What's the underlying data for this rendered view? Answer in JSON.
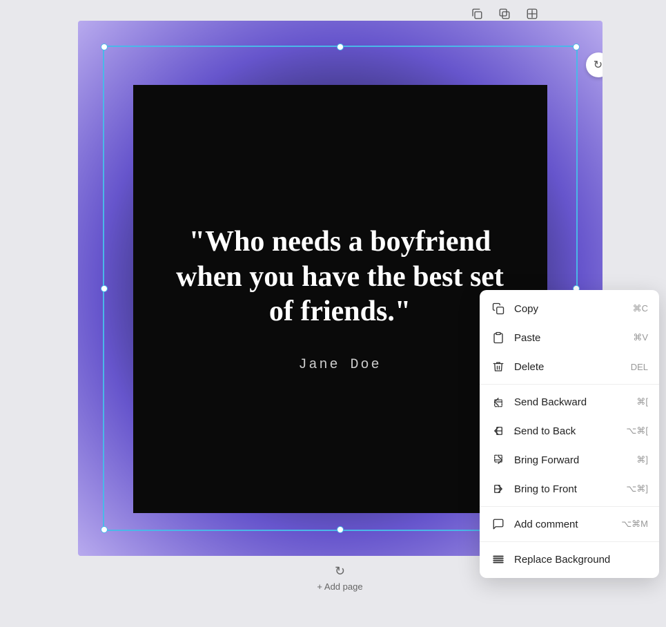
{
  "toolbar": {
    "icons": [
      "duplicate",
      "duplicate-page",
      "add-page"
    ]
  },
  "canvas": {
    "quote": "\"Who needs a boyfriend when you have the best set of friends.\"",
    "author": "Jane Doe"
  },
  "add_page_label": "+ Add page",
  "context_menu": {
    "items": [
      {
        "id": "copy",
        "label": "Copy",
        "shortcut": "⌘C",
        "icon": "copy"
      },
      {
        "id": "paste",
        "label": "Paste",
        "shortcut": "⌘V",
        "icon": "paste"
      },
      {
        "id": "delete",
        "label": "Delete",
        "shortcut": "DEL",
        "icon": "trash"
      },
      {
        "id": "send-backward",
        "label": "Send Backward",
        "shortcut": "⌘[",
        "icon": "send-backward"
      },
      {
        "id": "send-to-back",
        "label": "Send to Back",
        "shortcut": "⌥⌘[",
        "icon": "send-to-back"
      },
      {
        "id": "bring-forward",
        "label": "Bring Forward",
        "shortcut": "⌘]",
        "icon": "bring-forward"
      },
      {
        "id": "bring-to-front",
        "label": "Bring to Front",
        "shortcut": "⌥⌘]",
        "icon": "bring-to-front"
      },
      {
        "id": "add-comment",
        "label": "Add comment",
        "shortcut": "⌥⌘M",
        "icon": "comment"
      },
      {
        "id": "replace-bg",
        "label": "Replace Background",
        "shortcut": "",
        "icon": "replace-bg"
      }
    ]
  }
}
